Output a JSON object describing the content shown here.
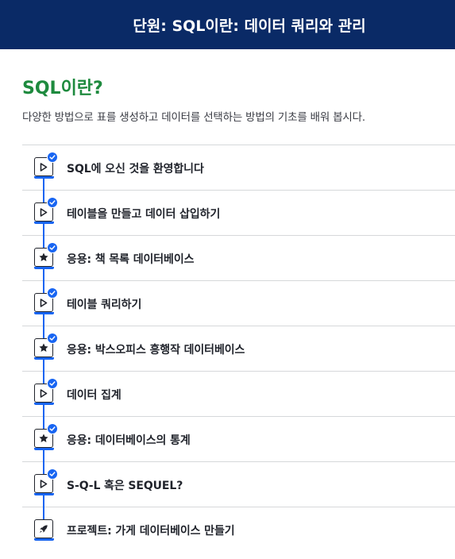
{
  "header": {
    "title": "단원: SQL이란: 데이터 쿼리와 관리"
  },
  "section": {
    "title": "SQL이란?",
    "description": "다양한 방법으로 표를 생성하고 데이터를 선택하는 방법의 기초를 배워 봅시다."
  },
  "items": [
    {
      "label": "SQL에 오신 것을 환영합니다",
      "icon": "play-icon",
      "completed": true
    },
    {
      "label": "테이블을 만들고 데이터 삽입하기",
      "icon": "play-icon",
      "completed": true
    },
    {
      "label": "응용: 책 목록 데이터베이스",
      "icon": "star-icon",
      "completed": true
    },
    {
      "label": "테이블 쿼리하기",
      "icon": "play-icon",
      "completed": true
    },
    {
      "label": "응용: 박스오피스 흥행작 데이터베이스",
      "icon": "star-icon",
      "completed": true
    },
    {
      "label": "데이터 집계",
      "icon": "play-icon",
      "completed": true
    },
    {
      "label": "응용: 데이터베이스의 통계",
      "icon": "star-icon",
      "completed": true
    },
    {
      "label": "S-Q-L 혹은 SEQUEL?",
      "icon": "play-icon",
      "completed": true
    },
    {
      "label": "프로젝트: 가게 데이터베이스 만들기",
      "icon": "rocket-icon",
      "completed": false
    }
  ],
  "colors": {
    "header_bg": "#0a2a66",
    "title_green": "#1e8a3e",
    "accent_blue": "#1865f2"
  }
}
